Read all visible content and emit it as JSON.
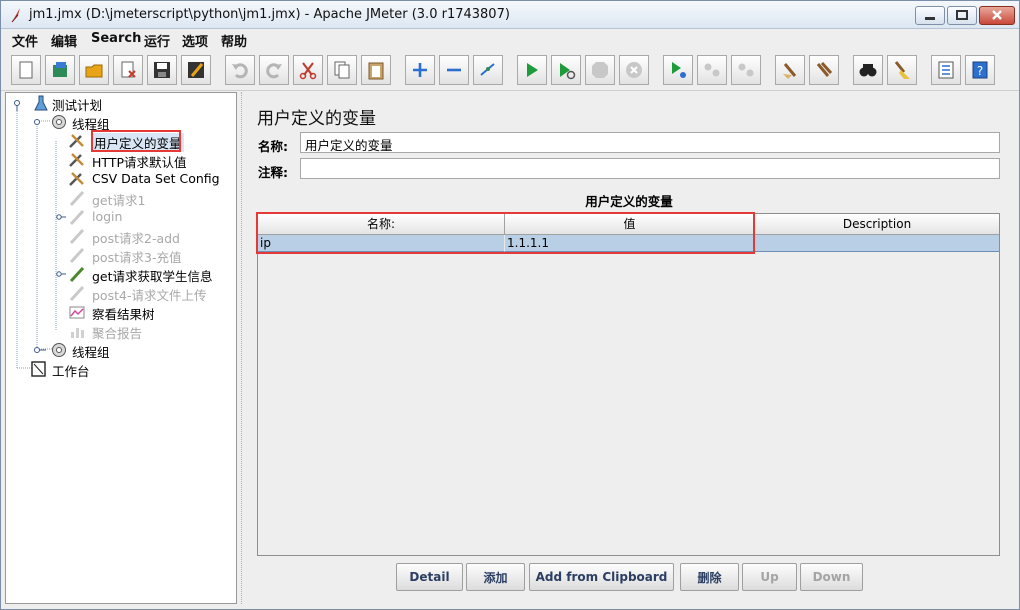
{
  "window": {
    "title": "jm1.jmx (D:\\jmeterscript\\python\\jm1.jmx) - Apache JMeter (3.0 r1743807)"
  },
  "menubar": {
    "items": [
      "文件",
      "编辑",
      "Search",
      "运行",
      "选项",
      "帮助"
    ]
  },
  "toolbar": {
    "icons": [
      "new-icon",
      "templates-icon",
      "open-icon",
      "close-icon",
      "save-icon",
      "save-as-icon",
      "undo-icon",
      "redo-icon",
      "cut-icon",
      "copy-icon",
      "paste-icon",
      "expand-icon",
      "collapse-icon",
      "toggle-icon",
      "start-icon",
      "start-no-pause-icon",
      "stop-icon",
      "shutdown-icon",
      "remote-start-icon",
      "remote-stop-icon",
      "remote-shutdown-icon",
      "clear-icon",
      "clear-all-icon",
      "search-icon",
      "reset-search-icon",
      "function-helper-icon",
      "help-icon"
    ]
  },
  "tree": {
    "nodes": [
      {
        "label": "测试计划",
        "icon": "test-plan-icon",
        "disabled": false
      },
      {
        "label": "线程组",
        "icon": "thread-group-icon",
        "disabled": false
      },
      {
        "label": "用户定义的变量",
        "icon": "config-element-icon",
        "disabled": false,
        "selected": true
      },
      {
        "label": "HTTP请求默认值",
        "icon": "config-element-icon",
        "disabled": false
      },
      {
        "label": "CSV Data Set Config",
        "icon": "config-element-icon",
        "disabled": false
      },
      {
        "label": "get请求1",
        "icon": "sampler-icon",
        "disabled": true
      },
      {
        "label": "login",
        "icon": "sampler-icon",
        "disabled": true
      },
      {
        "label": "post请求2-add",
        "icon": "sampler-icon",
        "disabled": true
      },
      {
        "label": "post请求3-充值",
        "icon": "sampler-icon",
        "disabled": true
      },
      {
        "label": "get请求获取学生信息",
        "icon": "sampler-icon",
        "disabled": false
      },
      {
        "label": "post4-请求文件上传",
        "icon": "sampler-icon",
        "disabled": true
      },
      {
        "label": "察看结果树",
        "icon": "listener-icon",
        "disabled": false
      },
      {
        "label": "聚合报告",
        "icon": "listener-icon",
        "disabled": true
      },
      {
        "label": "线程组",
        "icon": "thread-group-icon",
        "disabled": false
      },
      {
        "label": "工作台",
        "icon": "workbench-icon",
        "disabled": false
      }
    ]
  },
  "main": {
    "title": "用户定义的变量",
    "name_label": "名称:",
    "name_value": "用户定义的变量",
    "comment_label": "注释:",
    "comment_value": "",
    "section_title": "用户定义的变量",
    "table": {
      "headers": [
        "名称:",
        "值",
        "Description"
      ],
      "rows": [
        [
          "ip",
          "1.1.1.1",
          ""
        ]
      ]
    },
    "buttons": [
      {
        "label": "Detail",
        "enabled": true
      },
      {
        "label": "添加",
        "enabled": true
      },
      {
        "label": "Add from Clipboard",
        "enabled": true
      },
      {
        "label": "删除",
        "enabled": true
      },
      {
        "label": "Up",
        "enabled": false
      },
      {
        "label": "Down",
        "enabled": false
      }
    ]
  },
  "colors": {
    "highlight": "#e53935",
    "selected_row": "#b8cfe5"
  }
}
